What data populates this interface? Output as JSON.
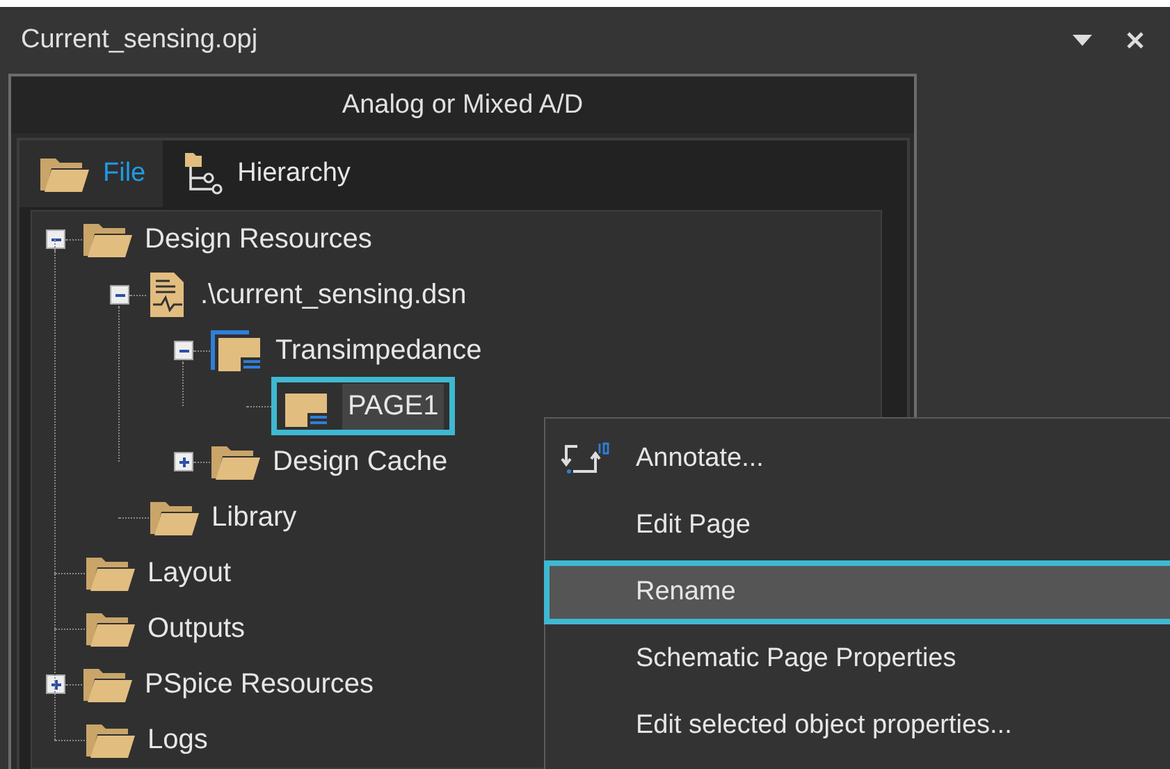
{
  "window": {
    "title": "Current_sensing.opj"
  },
  "panel": {
    "header": "Analog or Mixed A/D"
  },
  "tabs": [
    {
      "label": "File",
      "selected": true,
      "kind": "folder"
    },
    {
      "label": "Hierarchy",
      "selected": false,
      "kind": "hierarchy"
    }
  ],
  "tree": [
    {
      "label": "Design Resources",
      "kind": "folder",
      "expanded": true,
      "selected": false,
      "children": [
        {
          "label": ".\\current_sensing.dsn",
          "kind": "design",
          "expanded": true,
          "selected": false,
          "children": [
            {
              "label": "Transimpedance",
              "kind": "schematic",
              "expanded": true,
              "selected": false,
              "children": [
                {
                  "label": "PAGE1",
                  "kind": "page",
                  "selected": true
                }
              ]
            },
            {
              "label": "Design Cache",
              "kind": "folder",
              "expanded": false,
              "selected": false
            }
          ]
        },
        {
          "label": "Library",
          "kind": "folder",
          "selected": false
        }
      ]
    },
    {
      "label": "Layout",
      "kind": "folder",
      "selected": false
    },
    {
      "label": "Outputs",
      "kind": "folder",
      "selected": false
    },
    {
      "label": "PSpice Resources",
      "kind": "folder",
      "expanded": false,
      "selected": false
    },
    {
      "label": "Logs",
      "kind": "folder",
      "selected": false
    }
  ],
  "context_menu": [
    {
      "label": "Annotate...",
      "kind": "icon",
      "selected": false
    },
    {
      "label": "Edit Page",
      "kind": "plain",
      "selected": false
    },
    {
      "label": "Rename",
      "kind": "plain",
      "selected": true
    },
    {
      "label": "Schematic Page Properties",
      "kind": "plain",
      "selected": false
    },
    {
      "label": "Edit selected object properties...",
      "kind": "plain",
      "selected": false
    }
  ]
}
